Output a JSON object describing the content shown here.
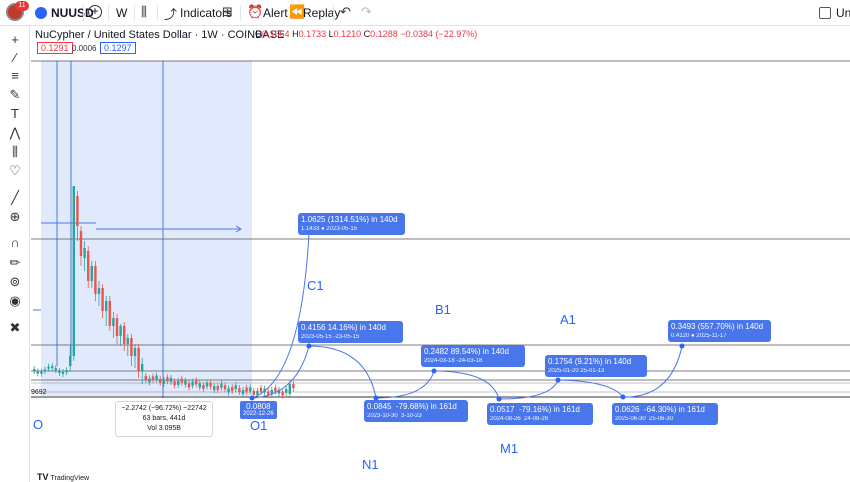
{
  "toolbar": {
    "notif_count": "11",
    "symbol": "NUUSD",
    "interval": "W",
    "indicators_label": "Indicators",
    "alert_label": "Alert",
    "replay_label": "Replay",
    "right_label": "Unn"
  },
  "legend": {
    "title": "NuCypher / United States Dollar · 1W · COINBASE",
    "open_label": "O",
    "open": "0.1664",
    "high_label": "H",
    "high": "0.1733",
    "low_label": "L",
    "low": "0.1210",
    "close_label": "C",
    "close": "0.1288",
    "change": "−0.0384 (−22.97%)",
    "sell_price": "0.1291",
    "spread": "0.0006",
    "buy_price": "0.1297"
  },
  "annotations": [
    {
      "line1": "1.0625 (1314.51%) in 140d",
      "line2": "1.1433 ● 2023-05-15"
    },
    {
      "line1": "0.4156    14.16%) in 140d",
      "line2": "2023-05-15   -23-05-15"
    },
    {
      "line1": "0.2482     89.54%) in 140d",
      "line2": "2024-03-18  -24-03-18"
    },
    {
      "line1": "0.1754    (9.21%) in 140d",
      "line2": "2025-01-20   25-01-13"
    },
    {
      "line1": "0.3493 (557.70%) in 140d",
      "line2": "0.4120 ● 2025-11-17"
    }
  ],
  "date_boxes": [
    {
      "value": "0.0808",
      "date": "2022-12-26"
    },
    {
      "value": "0.0845",
      "date": "2023-10-30"
    },
    {
      "value": "0.0517",
      "date": "2024-08-26"
    },
    {
      "value": "0.0626",
      "date": "2025-06-30"
    }
  ],
  "drop_labels": [
    {
      "line1": "-79.68%) in 161d",
      "line2": "3-10-23"
    },
    {
      "line1": "-79.16%) in 161d",
      "line2": "24-08-26"
    },
    {
      "line1": "-64.30%) in 161d",
      "line2": "25-06-30"
    }
  ],
  "waves": {
    "c1": "C1",
    "b1": "B1",
    "a1": "A1",
    "o1": "O1",
    "n1": "N1",
    "m1": "M1",
    "o_left": "O"
  },
  "measure": {
    "line1": "−2.2742 (−96.72%) −22742",
    "line2": "63 bars, 441d",
    "line3": "Vol 3.095B"
  },
  "axis_tag": "9692",
  "brand": "TradingView",
  "colors": {
    "up": "#26a69a",
    "down": "#ef5350",
    "accent": "#2962ff",
    "annotation_bg": "#4a76ec",
    "measure_fill": "#dce5fc"
  },
  "icons": [
    "crosshair-icon",
    "trend-line-icon",
    "fib-icon",
    "brush-icon",
    "text-icon",
    "pattern-icon",
    "measure-icon",
    "heart-icon",
    "ruler-icon",
    "zoom-icon",
    "magnet-icon",
    "lock-icon",
    "eye-icon",
    "trash-icon"
  ]
}
